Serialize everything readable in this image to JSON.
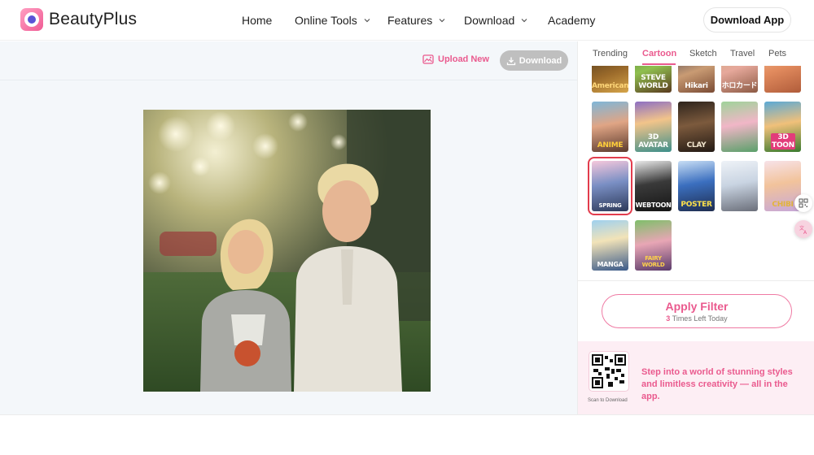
{
  "nav": {
    "brand": "BeautyPlus",
    "items": [
      {
        "label": "Home",
        "has_dropdown": false
      },
      {
        "label": "Online Tools",
        "has_dropdown": true
      },
      {
        "label": "Features",
        "has_dropdown": true
      },
      {
        "label": "Download",
        "has_dropdown": true
      },
      {
        "label": "Academy",
        "has_dropdown": false
      }
    ],
    "download_app": "Download App"
  },
  "toolbar": {
    "upload_new": "Upload New",
    "download": "Download"
  },
  "photo": {
    "icon": "photo-two-children-icon"
  },
  "panel": {
    "tabs": [
      "Trending",
      "Cartoon",
      "Sketch",
      "Travel",
      "Pets"
    ],
    "active_tab": "Cartoon",
    "thumbnails": [
      {
        "label": "Americana"
      },
      {
        "label": "STEVE WORLD"
      },
      {
        "label": "Hikari"
      },
      {
        "label": "ホロカード"
      },
      {
        "label": ""
      },
      {
        "label": "ANIME"
      },
      {
        "label": "3D AVATAR"
      },
      {
        "label": "CLAY"
      },
      {
        "label": ""
      },
      {
        "label": "3D TOON"
      },
      {
        "label": "SPRING"
      },
      {
        "label": "WEBTOON"
      },
      {
        "label": "POSTER"
      },
      {
        "label": ""
      },
      {
        "label": "CHIBI"
      },
      {
        "label": "MANGA"
      },
      {
        "label": "FAIRY WORLD"
      }
    ],
    "selected_index": 10,
    "apply": {
      "title": "Apply Filter",
      "times_left": "3",
      "times_left_suffix": " Times Left Today"
    },
    "promo": {
      "text": "Step into a world of stunning styles and limitless creativity — all in the app.",
      "scan": "Scan to Download"
    }
  },
  "colors": {
    "accent": "#ea5a8e",
    "selected_outline": "#e23c4c",
    "download_button": "#bfbfbf",
    "promo_bg": "#fdeef4",
    "workarea_bg": "#f4f7fa"
  }
}
